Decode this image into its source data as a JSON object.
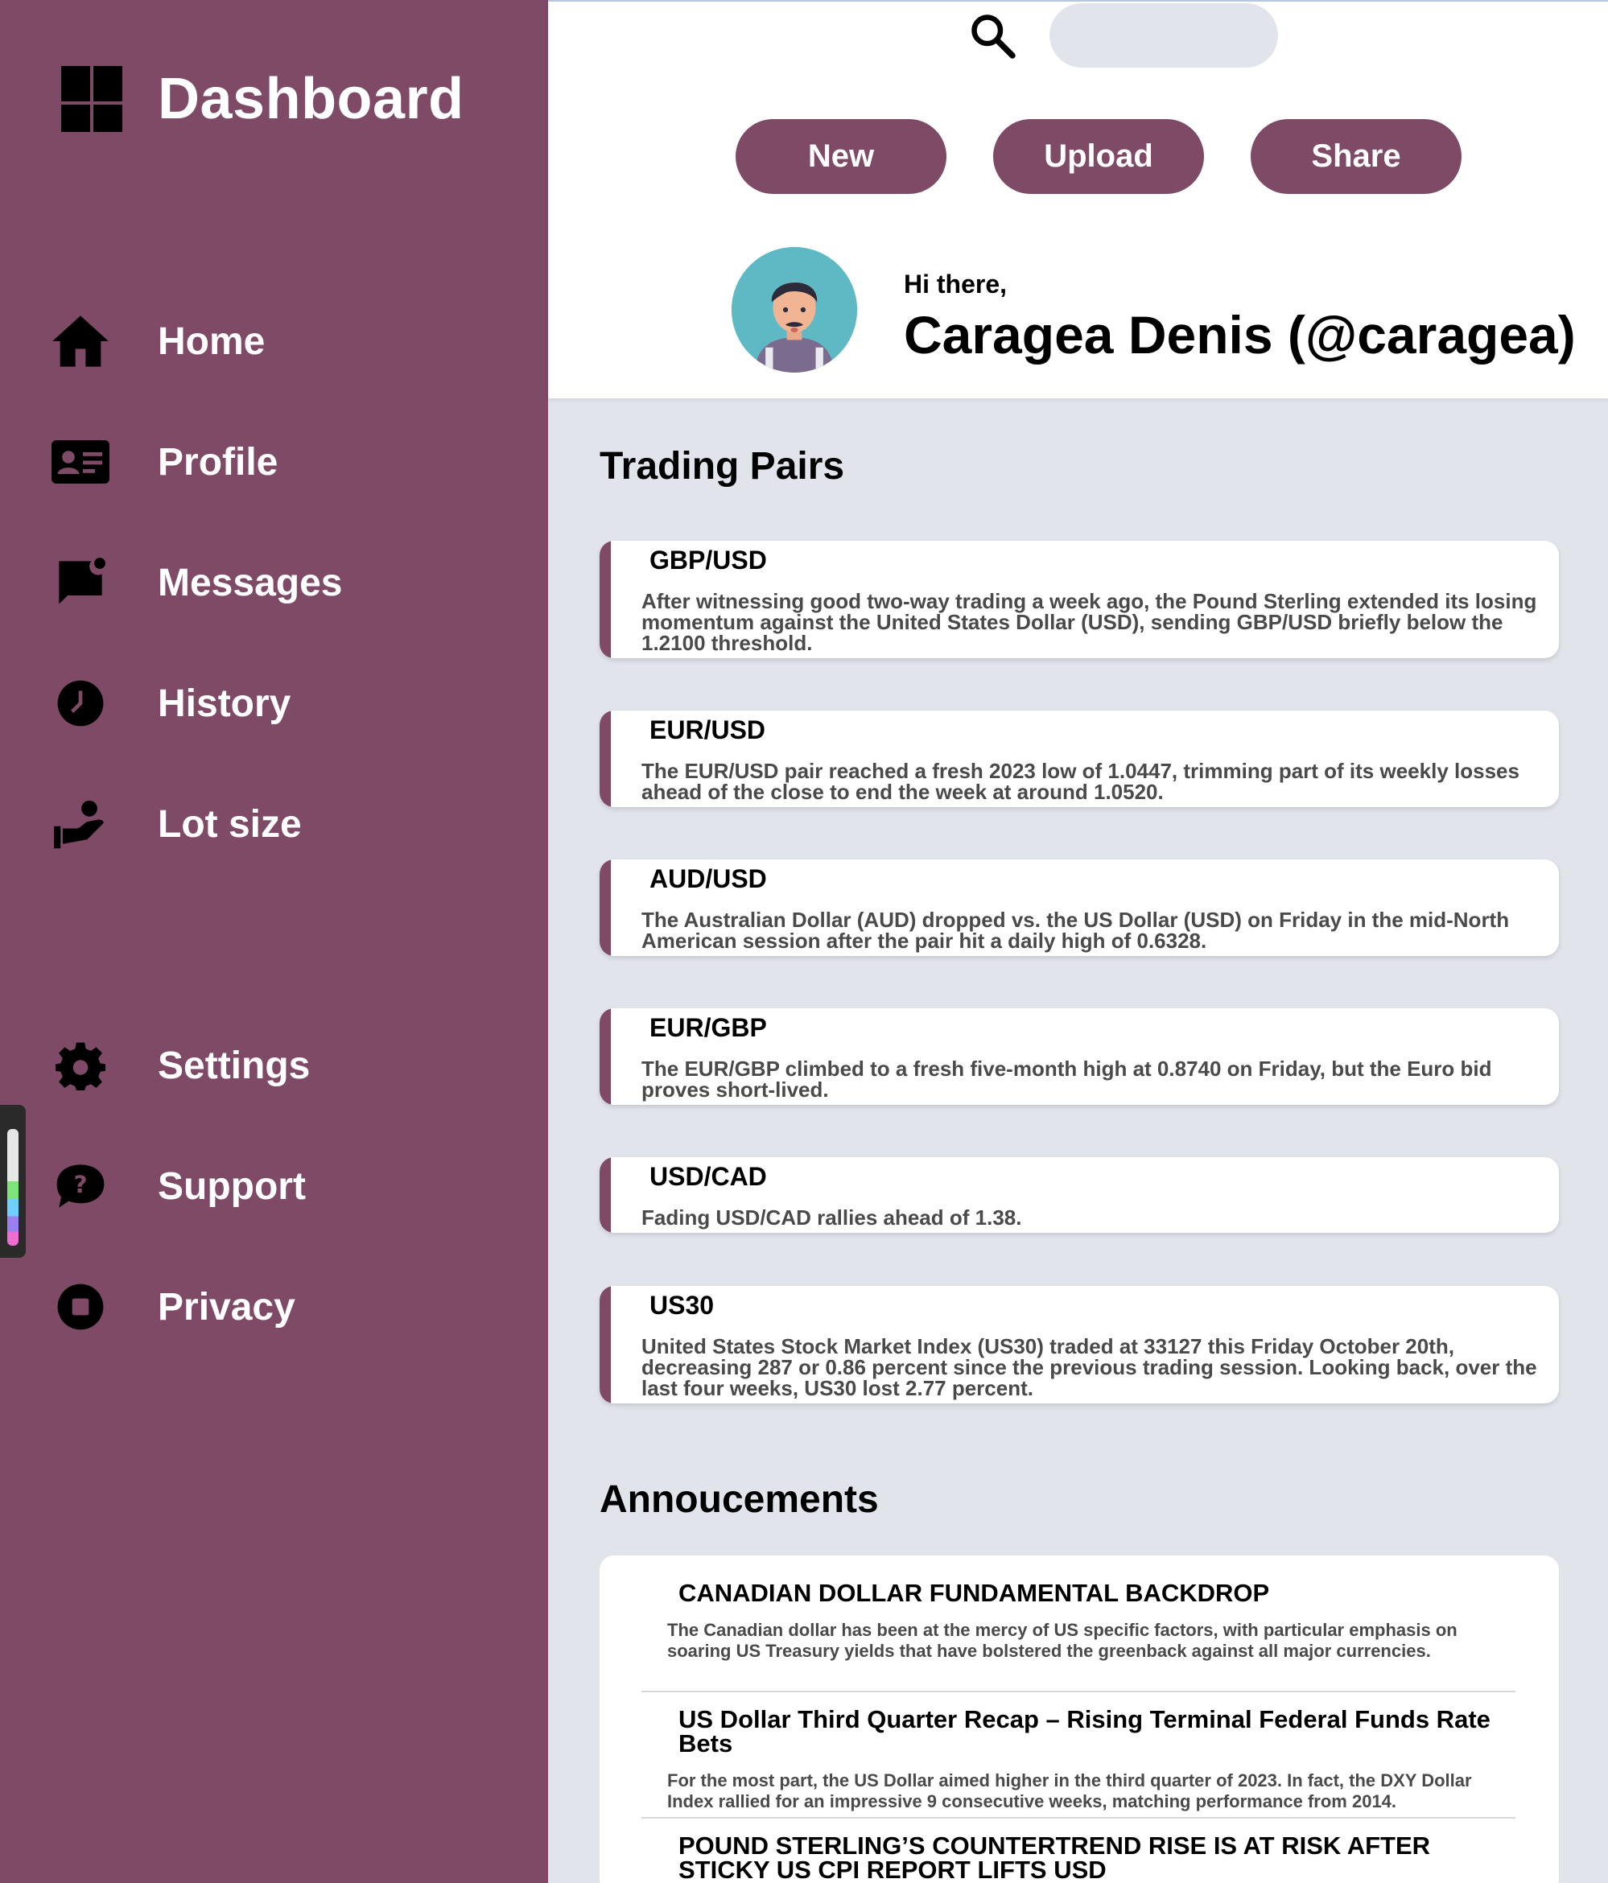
{
  "sidebar": {
    "brand_title": "Dashboard",
    "items": [
      {
        "label": "Home",
        "icon": "home-icon"
      },
      {
        "label": "Profile",
        "icon": "id-card-icon"
      },
      {
        "label": "Messages",
        "icon": "message-icon"
      },
      {
        "label": "History",
        "icon": "clock-icon"
      },
      {
        "label": "Lot size",
        "icon": "hand-person-icon"
      },
      {
        "label": "Settings",
        "icon": "gear-icon"
      },
      {
        "label": "Support",
        "icon": "help-bubble-icon"
      },
      {
        "label": "Privacy",
        "icon": "stop-circle-icon"
      }
    ],
    "accent_color": "#7e4a66"
  },
  "header": {
    "search": {
      "placeholder": "",
      "value": ""
    },
    "buttons": {
      "new": "New",
      "upload": "Upload",
      "share": "Share"
    },
    "greeting": "Hi there,",
    "user_name": "Caragea Denis (@caragea)"
  },
  "trading": {
    "title": "Trading Pairs",
    "pairs": [
      {
        "name": "GBP/USD",
        "desc": "After witnessing good two-way trading a week ago, the Pound Sterling extended its losing momentum against the United States Dollar (USD), sending GBP/USD briefly below the 1.2100 threshold."
      },
      {
        "name": "EUR/USD",
        "desc": "The EUR/USD pair reached a fresh 2023 low of 1.0447, trimming part of its weekly losses ahead of the close to end the week at around 1.0520."
      },
      {
        "name": "AUD/USD",
        "desc": "The Australian Dollar (AUD) dropped vs. the US Dollar (USD) on Friday in the mid-North American session after the pair hit a daily high of 0.6328."
      },
      {
        "name": "EUR/GBP",
        "desc": "The EUR/GBP climbed to a fresh five-month high at 0.8740 on Friday, but the Euro bid proves short-lived."
      },
      {
        "name": "USD/CAD",
        "desc": "Fading USD/CAD rallies ahead of 1.38."
      },
      {
        "name": "US30",
        "desc": "United States Stock Market Index (US30) traded at 33127 this Friday October 20th, decreasing 287 or 0.86 percent since the previous trading session. Looking back, over the last four weeks, US30 lost 2.77 percent."
      }
    ]
  },
  "announcements": {
    "title": "Annoucements",
    "items": [
      {
        "title": "CANADIAN DOLLAR FUNDAMENTAL BACKDROP",
        "body": "The Canadian dollar has been at the mercy of US specific factors, with particular emphasis on soaring US Treasury yields that have bolstered the greenback against all major currencies."
      },
      {
        "title": "US Dollar Third Quarter Recap – Rising Terminal Federal Funds Rate Bets",
        "body": "For the most part, the US Dollar aimed higher in the third quarter of 2023. In fact, the DXY Dollar Index rallied for an impressive 9 consecutive weeks, matching performance from 2014."
      },
      {
        "title": "POUND STERLING’S COUNTERTREND RISE IS AT RISK AFTER STICKY US CPI REPORT LIFTS USD",
        "body": ""
      }
    ]
  }
}
